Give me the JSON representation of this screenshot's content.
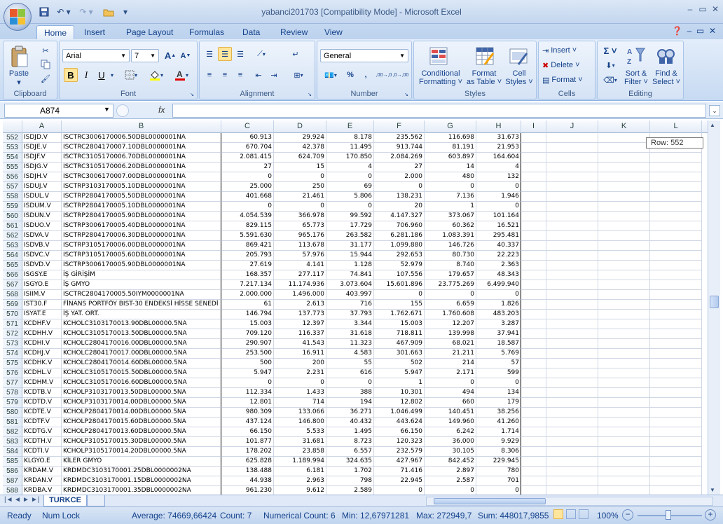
{
  "window": {
    "title": "yabanci201703  [Compatibility Mode] - Microsoft Excel",
    "controls": [
      "–",
      "▭",
      "✕"
    ]
  },
  "qat": {
    "save_icon": "save-icon",
    "undo_icon": "undo-icon",
    "redo_icon": "redo-icon",
    "open_icon": "open-folder-icon"
  },
  "ribbon": {
    "tabs": [
      "Home",
      "Insert",
      "Page Layout",
      "Formulas",
      "Data",
      "Review",
      "View"
    ],
    "active_tab": "Home",
    "groups": {
      "clipboard": "Clipboard",
      "font": "Font",
      "alignment": "Alignment",
      "number": "Number",
      "styles": "Styles",
      "cells": "Cells",
      "editing": "Editing"
    },
    "paste": "Paste",
    "font_name": "Arial",
    "font_size": "7",
    "bold": "B",
    "italic": "I",
    "underline": "U",
    "number_format": "General",
    "percent": "%",
    "comma": ",",
    "inc_dec": ",00→,0",
    "dec_dec": ",0→,00",
    "conditional_formatting": [
      "Conditional",
      "Formatting ˅"
    ],
    "format_as_table": [
      "Format",
      "as Table ˅"
    ],
    "cell_styles": [
      "Cell",
      "Styles ˅"
    ],
    "insert": "Insert ˅",
    "delete": "Delete ˅",
    "format": "Format ˅",
    "sigma": "Σ ˅",
    "sort_filter": [
      "Sort &",
      "Filter ˅"
    ],
    "find_select": [
      "Find &",
      "Select ˅"
    ]
  },
  "formula_bar": {
    "name_box": "A874",
    "fx": "fx",
    "value": ""
  },
  "columns": [
    "A",
    "B",
    "C",
    "D",
    "E",
    "F",
    "G",
    "H",
    "I",
    "J",
    "K",
    "L"
  ],
  "row_tooltip": "Row: 552",
  "rows": [
    {
      "n": "552",
      "a": "ISDJD.V",
      "b": "ISCTRC3006170006.50DBL0000001NA",
      "c": "60.913",
      "d": "29.924",
      "e": "8.178",
      "f": "235.562",
      "g": "116.698",
      "h": "31.673"
    },
    {
      "n": "553",
      "a": "ISDJE.V",
      "b": "ISCTRC2804170007.10DBL0000001NA",
      "c": "670.704",
      "d": "42.378",
      "e": "11.495",
      "f": "913.744",
      "g": "81.191",
      "h": "21.953"
    },
    {
      "n": "554",
      "a": "ISDJF.V",
      "b": "ISCTRC3105170006.70DBL0000001NA",
      "c": "2.081.415",
      "d": "624.709",
      "e": "170.850",
      "f": "2.084.269",
      "g": "603.897",
      "h": "164.604"
    },
    {
      "n": "555",
      "a": "ISDJG.V",
      "b": "ISCTRC3105170006.20DBL0000001NA",
      "c": "27",
      "d": "15",
      "e": "4",
      "f": "27",
      "g": "14",
      "h": "4"
    },
    {
      "n": "556",
      "a": "ISDJH.V",
      "b": "ISCTRC3006170007.00DBL0000001NA",
      "c": "0",
      "d": "0",
      "e": "0",
      "f": "2.000",
      "g": "480",
      "h": "132"
    },
    {
      "n": "557",
      "a": "ISDUJ.V",
      "b": "ISCTRP3103170005.10DBL0000001NA",
      "c": "25.000",
      "d": "250",
      "e": "69",
      "f": "0",
      "g": "0",
      "h": "0"
    },
    {
      "n": "558",
      "a": "ISDUL.V",
      "b": "ISCTRP2804170005.50DBL0000001NA",
      "c": "401.668",
      "d": "21.461",
      "e": "5.806",
      "f": "138.231",
      "g": "7.136",
      "h": "1.946"
    },
    {
      "n": "559",
      "a": "ISDUM.V",
      "b": "ISCTRP2804170005.10DBL0000001NA",
      "c": "0",
      "d": "0",
      "e": "0",
      "f": "20",
      "g": "1",
      "h": "0"
    },
    {
      "n": "560",
      "a": "ISDUN.V",
      "b": "ISCTRP2804170005.90DBL0000001NA",
      "c": "4.054.539",
      "d": "366.978",
      "e": "99.592",
      "f": "4.147.327",
      "g": "373.067",
      "h": "101.164"
    },
    {
      "n": "561",
      "a": "ISDUO.V",
      "b": "ISCTRP3006170005.40DBL0000001NA",
      "c": "829.115",
      "d": "65.773",
      "e": "17.729",
      "f": "706.960",
      "g": "60.362",
      "h": "16.521"
    },
    {
      "n": "562",
      "a": "ISDVA.V",
      "b": "ISCTRP2804170006.30DBL0000001NA",
      "c": "5.591.630",
      "d": "965.176",
      "e": "263.582",
      "f": "6.281.186",
      "g": "1.083.391",
      "h": "295.481"
    },
    {
      "n": "563",
      "a": "ISDVB.V",
      "b": "ISCTRP3105170006.00DBL0000001NA",
      "c": "869.421",
      "d": "113.678",
      "e": "31.177",
      "f": "1.099.880",
      "g": "146.726",
      "h": "40.337"
    },
    {
      "n": "564",
      "a": "ISDVC.V",
      "b": "ISCTRP3105170005.60DBL0000001NA",
      "c": "205.793",
      "d": "57.976",
      "e": "15.944",
      "f": "292.653",
      "g": "80.730",
      "h": "22.223"
    },
    {
      "n": "565",
      "a": "ISDVD.V",
      "b": "ISCTRP3006170005.90DBL0000001NA",
      "c": "27.619",
      "d": "4.141",
      "e": "1.128",
      "f": "52.979",
      "g": "8.740",
      "h": "2.363"
    },
    {
      "n": "566",
      "a": "ISGSY.E",
      "b": "İŞ GİRİŞİM",
      "c": "168.357",
      "d": "277.117",
      "e": "74.841",
      "f": "107.556",
      "g": "179.657",
      "h": "48.343"
    },
    {
      "n": "567",
      "a": "ISGYO.E",
      "b": "İŞ GMYO",
      "c": "7.217.134",
      "d": "11.174.936",
      "e": "3.073.604",
      "f": "15.601.896",
      "g": "23.775.269",
      "h": "6.499.940"
    },
    {
      "n": "568",
      "a": "ISIIM.V",
      "b": "ISCTRC2804170005.50IYM0000001NA",
      "c": "2.000.000",
      "d": "1.496.000",
      "e": "403.997",
      "f": "0",
      "g": "0",
      "h": "0"
    },
    {
      "n": "569",
      "a": "IST30.F",
      "b": "FİNANS PORTFÖY BIST-30 ENDEKSİ HİSSE SENEDİ",
      "c": "61",
      "d": "2.613",
      "e": "716",
      "f": "155",
      "g": "6.659",
      "h": "1.826"
    },
    {
      "n": "570",
      "a": "ISYAT.E",
      "b": "İŞ YAT. ORT.",
      "c": "146.794",
      "d": "137.773",
      "e": "37.793",
      "f": "1.762.671",
      "g": "1.760.608",
      "h": "483.203"
    },
    {
      "n": "571",
      "a": "KCDHF.V",
      "b": "KCHOLC3103170013.90DBL00000.5NA",
      "c": "15.003",
      "d": "12.397",
      "e": "3.344",
      "f": "15.003",
      "g": "12.207",
      "h": "3.287"
    },
    {
      "n": "572",
      "a": "KCDHH.V",
      "b": "KCHOLC3105170013.50DBL00000.5NA",
      "c": "709.120",
      "d": "116.337",
      "e": "31.618",
      "f": "718.811",
      "g": "139.998",
      "h": "37.941"
    },
    {
      "n": "573",
      "a": "KCDHI.V",
      "b": "KCHOLC2804170016.00DBL00000.5NA",
      "c": "290.907",
      "d": "41.543",
      "e": "11.323",
      "f": "467.909",
      "g": "68.021",
      "h": "18.587"
    },
    {
      "n": "574",
      "a": "KCDHJ.V",
      "b": "KCHOLC2804170017.00DBL00000.5NA",
      "c": "253.500",
      "d": "16.911",
      "e": "4.583",
      "f": "301.663",
      "g": "21.211",
      "h": "5.769"
    },
    {
      "n": "575",
      "a": "KCDHK.V",
      "b": "KCHOLC2804170014.60DBL00000.5NA",
      "c": "500",
      "d": "200",
      "e": "55",
      "f": "502",
      "g": "214",
      "h": "57"
    },
    {
      "n": "576",
      "a": "KCDHL.V",
      "b": "KCHOLC3105170015.50DBL00000.5NA",
      "c": "5.947",
      "d": "2.231",
      "e": "616",
      "f": "5.947",
      "g": "2.171",
      "h": "599"
    },
    {
      "n": "577",
      "a": "KCDHM.V",
      "b": "KCHOLC3105170016.60DBL00000.5NA",
      "c": "0",
      "d": "0",
      "e": "0",
      "f": "1",
      "g": "0",
      "h": "0"
    },
    {
      "n": "578",
      "a": "KCDTB.V",
      "b": "KCHOLP3103170013.50DBL00000.5NA",
      "c": "112.334",
      "d": "1.433",
      "e": "388",
      "f": "10.301",
      "g": "494",
      "h": "134"
    },
    {
      "n": "579",
      "a": "KCDTD.V",
      "b": "KCHOLP3103170014.00DBL00000.5NA",
      "c": "12.801",
      "d": "714",
      "e": "194",
      "f": "12.802",
      "g": "660",
      "h": "179"
    },
    {
      "n": "580",
      "a": "KCDTE.V",
      "b": "KCHOLP2804170014.00DBL00000.5NA",
      "c": "980.309",
      "d": "133.066",
      "e": "36.271",
      "f": "1.046.499",
      "g": "140.451",
      "h": "38.256"
    },
    {
      "n": "581",
      "a": "KCDTF.V",
      "b": "KCHOLP2804170015.60DBL00000.5NA",
      "c": "437.124",
      "d": "146.800",
      "e": "40.432",
      "f": "443.624",
      "g": "149.960",
      "h": "41.260"
    },
    {
      "n": "582",
      "a": "KCDTG.V",
      "b": "KCHOLP2804170013.60DBL00000.5NA",
      "c": "66.150",
      "d": "5.533",
      "e": "1.495",
      "f": "66.150",
      "g": "6.242",
      "h": "1.714"
    },
    {
      "n": "583",
      "a": "KCDTH.V",
      "b": "KCHOLP3105170015.30DBL00000.5NA",
      "c": "101.877",
      "d": "31.681",
      "e": "8.723",
      "f": "120.323",
      "g": "36.000",
      "h": "9.929"
    },
    {
      "n": "584",
      "a": "KCDTI.V",
      "b": "KCHOLP3105170014.20DBL00000.5NA",
      "c": "178.202",
      "d": "23.858",
      "e": "6.557",
      "f": "232.579",
      "g": "30.105",
      "h": "8.306"
    },
    {
      "n": "585",
      "a": "KLGYO.E",
      "b": "KİLER GMYO",
      "c": "625.828",
      "d": "1.189.994",
      "e": "324.635",
      "f": "427.967",
      "g": "842.452",
      "h": "229.945"
    },
    {
      "n": "586",
      "a": "KRDAM.V",
      "b": "KRDMDC3103170001.25DBL0000002NA",
      "c": "138.488",
      "d": "6.181",
      "e": "1.702",
      "f": "71.416",
      "g": "2.897",
      "h": "780"
    },
    {
      "n": "587",
      "a": "KRDAN.V",
      "b": "KRDMDC3103170001.15DBL0000002NA",
      "c": "44.938",
      "d": "2.963",
      "e": "798",
      "f": "22.945",
      "g": "2.587",
      "h": "701"
    },
    {
      "n": "588",
      "a": "KRDBA.V",
      "b": "KRDMDC3103170001.35DBL0000002NA",
      "c": "961.230",
      "d": "9.612",
      "e": "2.589",
      "f": "0",
      "g": "0",
      "h": "0"
    }
  ],
  "sheet_tabs": {
    "active": "TURKCE",
    "nav": [
      "|◄",
      "◄",
      "►",
      "►|"
    ]
  },
  "status": {
    "ready": "Ready",
    "num_lock": "Num Lock",
    "average": "Average: 74669,66424",
    "count": "Count: 7",
    "numerical_count": "Numerical Count: 6",
    "min": "Min: 12,67971281",
    "max": "Max: 272949,7",
    "sum": "Sum: 448017,9855",
    "zoom": "100%"
  }
}
